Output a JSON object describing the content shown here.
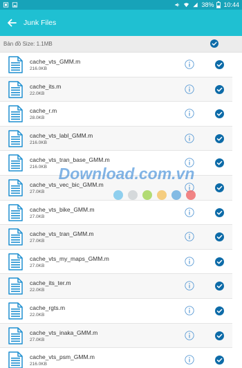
{
  "status_bar": {
    "battery_percent": "38%",
    "time": "10:44",
    "icons": [
      "notification-icon",
      "image-icon",
      "volume-icon",
      "wifi-icon",
      "signal-icon",
      "battery-icon"
    ]
  },
  "app_bar": {
    "title": "Junk Files",
    "back_icon": "arrow-back-icon"
  },
  "summary": {
    "label": "Bản đồ Size: 1.1MB",
    "checked": true
  },
  "files": [
    {
      "name": "cache_vts_GMM.m",
      "size": "216.0KB",
      "checked": true
    },
    {
      "name": "cache_its.m",
      "size": "22.0KB",
      "checked": true
    },
    {
      "name": "cache_r.m",
      "size": "28.0KB",
      "checked": true
    },
    {
      "name": "cache_vts_labl_GMM.m",
      "size": "216.0KB",
      "checked": true
    },
    {
      "name": "cache_vts_tran_base_GMM.m",
      "size": "216.0KB",
      "checked": true
    },
    {
      "name": "cache_vts_vec_bic_GMM.m",
      "size": "27.0KB",
      "checked": true
    },
    {
      "name": "cache_vts_bike_GMM.m",
      "size": "27.0KB",
      "checked": true
    },
    {
      "name": "cache_vts_tran_GMM.m",
      "size": "27.0KB",
      "checked": true
    },
    {
      "name": "cache_vts_my_maps_GMM.m",
      "size": "27.0KB",
      "checked": true
    },
    {
      "name": "cache_its_ter.m",
      "size": "22.0KB",
      "checked": true
    },
    {
      "name": "cache_rgts.m",
      "size": "22.0KB",
      "checked": true
    },
    {
      "name": "cache_vts_inaka_GMM.m",
      "size": "27.0KB",
      "checked": true
    },
    {
      "name": "cache_vts_psm_GMM.m",
      "size": "216.0KB",
      "checked": true
    }
  ],
  "watermark": {
    "text": "Download.com.vn",
    "dot_colors": [
      "#7cc8ec",
      "#cfd3d6",
      "#a6d65c",
      "#f5c56a",
      "#6fb0e0",
      "#f07070"
    ]
  },
  "colors": {
    "accent": "#1fc0d2",
    "status_bar": "#17a3b9",
    "check": "#0d6ba8",
    "file_icon": "#1e8fd0",
    "info_icon": "#5b9bd5"
  }
}
